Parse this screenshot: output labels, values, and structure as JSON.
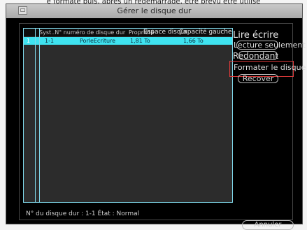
{
  "top_doc_text": "e formaté puis, après un redémarrage, être prévu être utilisé",
  "window": {
    "title": "Gérer le disque dur"
  },
  "table": {
    "columns": [
      "",
      "Syst..N° numéro de disque dur",
      "Propriété",
      "Espace disque",
      "Capacité gauche"
    ],
    "rows": [
      {
        "index": "1",
        "disk_no": "1-1",
        "property": "PorleEcriture",
        "space": "1,81 To",
        "free": "1,66 To"
      }
    ]
  },
  "side_options": {
    "read_write": "Lire écrire",
    "read_only": "Lecture seulement",
    "redundant": "Redondant",
    "format": "Formater le disque",
    "recover": "Recover"
  },
  "status_text": "N° du disque dur : 1-1 État : Normal",
  "cancel_label": "Annuler",
  "colors": {
    "selection": "#3fe3f0",
    "highlight": "#e03a3a",
    "background": "#000000"
  }
}
